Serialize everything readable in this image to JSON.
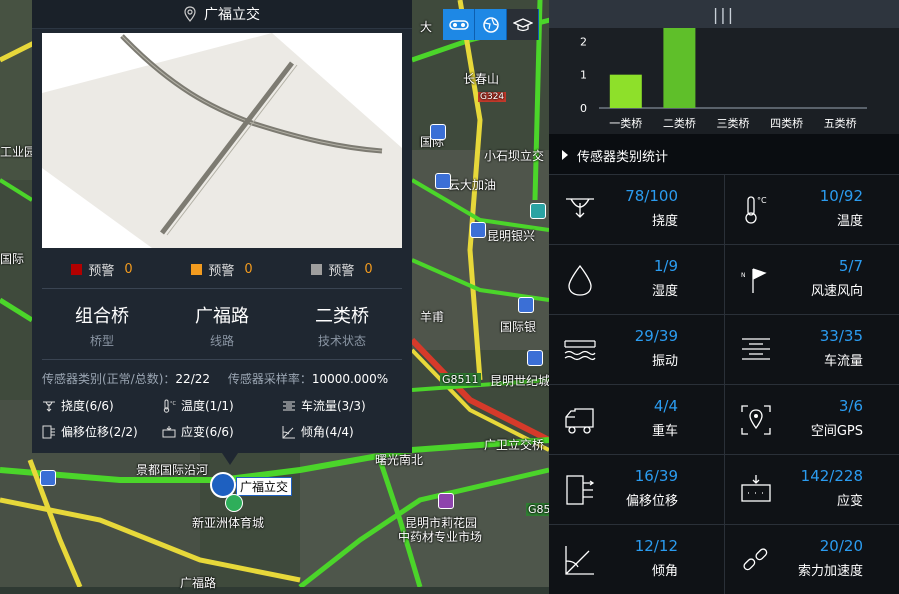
{
  "map": {
    "labels": [
      "长春山",
      "G324",
      "小石坝立交",
      "云大加油",
      "昆明银兴",
      "国际",
      "国际银",
      "羊甫",
      "G8511",
      "昆明世纪城",
      "广卫立交桥",
      "曙光南北",
      "景都国际沿河",
      "广福立交",
      "新亚洲体育城",
      "昆明市莉花园",
      "中药材专业市场",
      "G85",
      "国际",
      "工业园",
      "广福路",
      "大"
    ]
  },
  "toolbar": {
    "buttons": [
      "layers-icon",
      "globe-icon",
      "graduation-icon"
    ]
  },
  "popup": {
    "title": "广福立交",
    "warnings": [
      {
        "color": "#b30000",
        "label": "预警",
        "count": "0"
      },
      {
        "color": "#f29b1f",
        "label": "预警",
        "count": "0"
      },
      {
        "color": "#9e9e9e",
        "label": "预警",
        "count": "0"
      }
    ],
    "info": [
      {
        "value": "组合桥",
        "label": "桥型"
      },
      {
        "value": "广福路",
        "label": "线路"
      },
      {
        "value": "二类桥",
        "label": "技术状态"
      }
    ],
    "stats": {
      "type_label": "传感器类别(正常/总数)：",
      "type_value": "22/22",
      "rate_label": "传感器采样率：",
      "rate_value": "10000.000%"
    },
    "sensors": [
      {
        "label": "挠度(6/6)",
        "icon": "deflection-icon"
      },
      {
        "label": "温度(1/1)",
        "icon": "temperature-icon"
      },
      {
        "label": "车流量(3/3)",
        "icon": "traffic-icon"
      },
      {
        "label": "偏移位移(2/2)",
        "icon": "offset-icon"
      },
      {
        "label": "应变(6/6)",
        "icon": "strain-icon"
      },
      {
        "label": "倾角(4/4)",
        "icon": "tilt-icon"
      }
    ]
  },
  "right": {
    "drag_handle": "|||",
    "section_title": "传感器类别统计",
    "tiles": [
      {
        "count": "78/100",
        "name": "挠度",
        "icon": "deflection-icon"
      },
      {
        "count": "10/92",
        "name": "温度",
        "icon": "temperature-icon"
      },
      {
        "count": "1/9",
        "name": "湿度",
        "icon": "humidity-icon"
      },
      {
        "count": "5/7",
        "name": "风速风向",
        "icon": "wind-icon"
      },
      {
        "count": "29/39",
        "name": "振动",
        "icon": "vibration-icon"
      },
      {
        "count": "33/35",
        "name": "车流量",
        "icon": "traffic-icon"
      },
      {
        "count": "4/4",
        "name": "重车",
        "icon": "truck-icon"
      },
      {
        "count": "3/6",
        "name": "空间GPS",
        "icon": "gps-icon"
      },
      {
        "count": "16/39",
        "name": "偏移位移",
        "icon": "offset-icon"
      },
      {
        "count": "142/228",
        "name": "应变",
        "icon": "strain-icon"
      },
      {
        "count": "12/12",
        "name": "倾角",
        "icon": "tilt-icon"
      },
      {
        "count": "20/20",
        "name": "索力加速度",
        "icon": "cable-icon"
      }
    ]
  },
  "chart_data": {
    "type": "bar",
    "categories": [
      "一类桥",
      "二类桥",
      "三类桥",
      "四类桥",
      "五类桥"
    ],
    "values": [
      1,
      3,
      0,
      0,
      0
    ],
    "yticks": [
      "0",
      "1",
      "2"
    ],
    "ylim": [
      0,
      3
    ],
    "colors": [
      "#8ee02a",
      "#5fbf2a",
      "#5fbf2a",
      "#5fbf2a",
      "#5fbf2a"
    ]
  }
}
